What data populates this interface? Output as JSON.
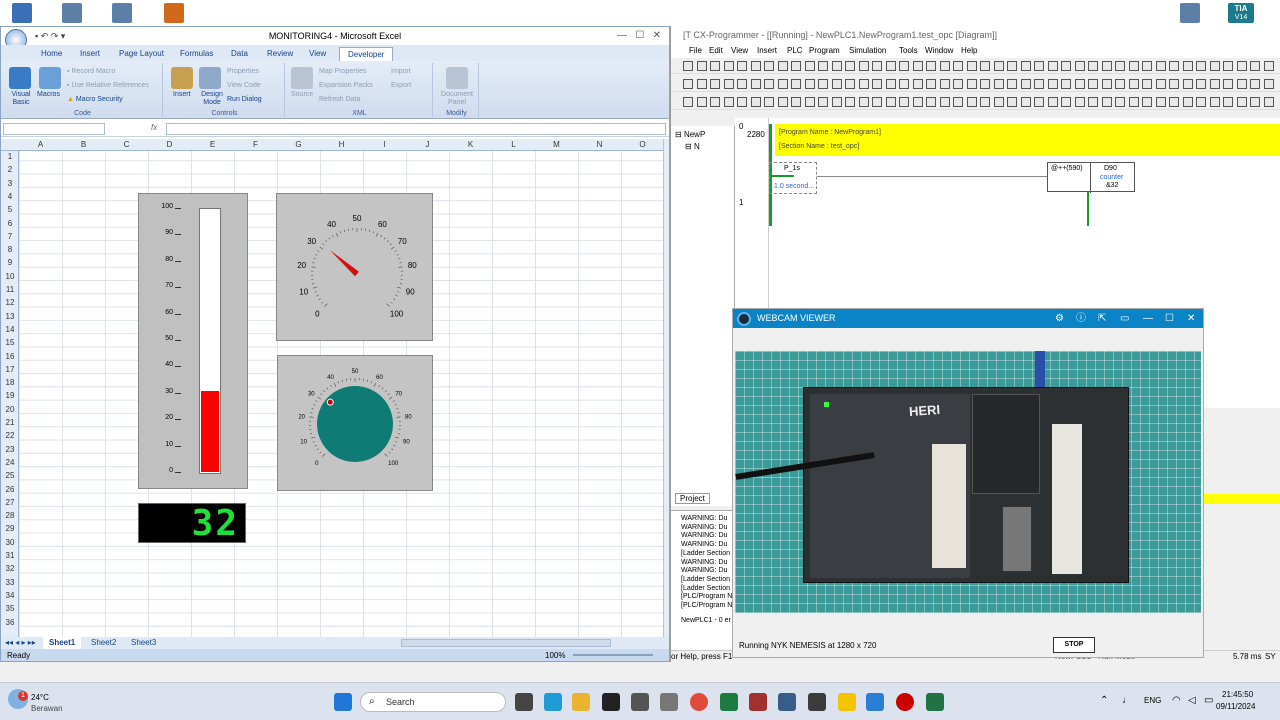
{
  "desktop": {
    "tia_label": "TIA",
    "tia_version": "V14"
  },
  "excel": {
    "title": "MONITORING4 - Microsoft Excel",
    "tabs": [
      "Home",
      "Insert",
      "Page Layout",
      "Formulas",
      "Data",
      "Review",
      "View",
      "Developer"
    ],
    "ribbon": {
      "code_group": "Code",
      "visual_basic": "Visual Basic",
      "macros": "Macros",
      "record_macro": "Record Macro",
      "use_relative": "Use Relative References",
      "macro_security": "Macro Security",
      "controls_group": "Controls",
      "insert": "Insert",
      "design_mode": "Design Mode",
      "properties": "Properties",
      "view_code": "View Code",
      "run_dialog": "Run Dialog",
      "xml_group": "XML",
      "source": "Source",
      "map_properties": "Map Properties",
      "expansion_packs": "Expansion Packs",
      "refresh_data": "Refresh Data",
      "import": "Import",
      "export": "Export",
      "modify_group": "Modify",
      "document_panel": "Document Panel"
    },
    "fx": "fx",
    "columns": [
      "A",
      "B",
      "C",
      "D",
      "E",
      "F",
      "G",
      "H",
      "I",
      "J",
      "K",
      "L",
      "M",
      "N",
      "O"
    ],
    "rows": [
      "1",
      "2",
      "3",
      "4",
      "5",
      "6",
      "7",
      "8",
      "9",
      "10",
      "11",
      "12",
      "13",
      "14",
      "15",
      "16",
      "17",
      "18",
      "19",
      "20",
      "21",
      "22",
      "23",
      "24",
      "25",
      "26",
      "27",
      "28",
      "29",
      "30",
      "31",
      "32",
      "33",
      "34",
      "35",
      "36"
    ],
    "sheets": [
      "Sheet1",
      "Sheet2",
      "Sheet3"
    ],
    "status_ready": "Ready",
    "zoom": "100%"
  },
  "widgets": {
    "thermo_ticks": [
      "100",
      "90",
      "80",
      "70",
      "60",
      "50",
      "40",
      "30",
      "20",
      "10",
      "0"
    ],
    "thermo_level": 0.31,
    "gauge_ticks": [
      "0",
      "10",
      "20",
      "30",
      "40",
      "50",
      "60",
      "70",
      "80",
      "90",
      "100"
    ],
    "gauge_value": 32,
    "knob_ticks": [
      "0",
      "10",
      "20",
      "30",
      "40",
      "50",
      "60",
      "70",
      "80",
      "90",
      "100"
    ],
    "knob_value": 32,
    "digital": "32",
    "color_bar": "#ff0000",
    "color_needle": "#d01010",
    "color_knob": "#0e7c74",
    "color_digit": "#22e03a"
  },
  "cx": {
    "title": "CX-Programmer - [[Running] - NewPLC1.NewProgram1.test_opc [Diagram]]",
    "title_prefix": "[T",
    "menu": [
      "File",
      "Edit",
      "View",
      "Insert",
      "PLC",
      "Program",
      "Simulation",
      "Tools",
      "Window",
      "Help"
    ],
    "tree_root": "NewP",
    "tree_child": "N",
    "project_tab": "Project",
    "rung0_num": "0",
    "rung0_addr": "2280",
    "program_name": "[Program Name : NewProgram1]",
    "section_name": "[Section Name : test_opc]",
    "contact_label": "P_1s",
    "contact_comment": "1.0 second...",
    "instr": "@++(590)",
    "instr_operand": "D90",
    "instr_comment": "counter",
    "instr_value": "&32",
    "rung1_num": "1",
    "output": [
      "WARNING: Du",
      "WARNING: Du",
      "WARNING: Du",
      "WARNING: Du",
      "[Ladder Section",
      "WARNING: Du",
      "WARNING: Du",
      "[Ladder Section",
      "[Ladder Section",
      "[PLC/Program N",
      "[PLC/Program N"
    ],
    "output_footer": "NewPLC1 - 0 er",
    "help_status": "or Help, press F1",
    "run_mode": "NewPLC1 - Run Mode",
    "scan_time": "5.78 ms",
    "sync": "SY"
  },
  "cam": {
    "title": "WEBCAM VIEWER",
    "status": "Running NYK NEMESIS at 1280 x 720",
    "stop": "STOP",
    "plc_label": "HERI"
  },
  "taskbar": {
    "temp": "24°C",
    "weather": "Berawan",
    "search": "Search",
    "lang": "ENG",
    "time": "21:45:50",
    "date": "09/11/2024",
    "badge": "1"
  }
}
